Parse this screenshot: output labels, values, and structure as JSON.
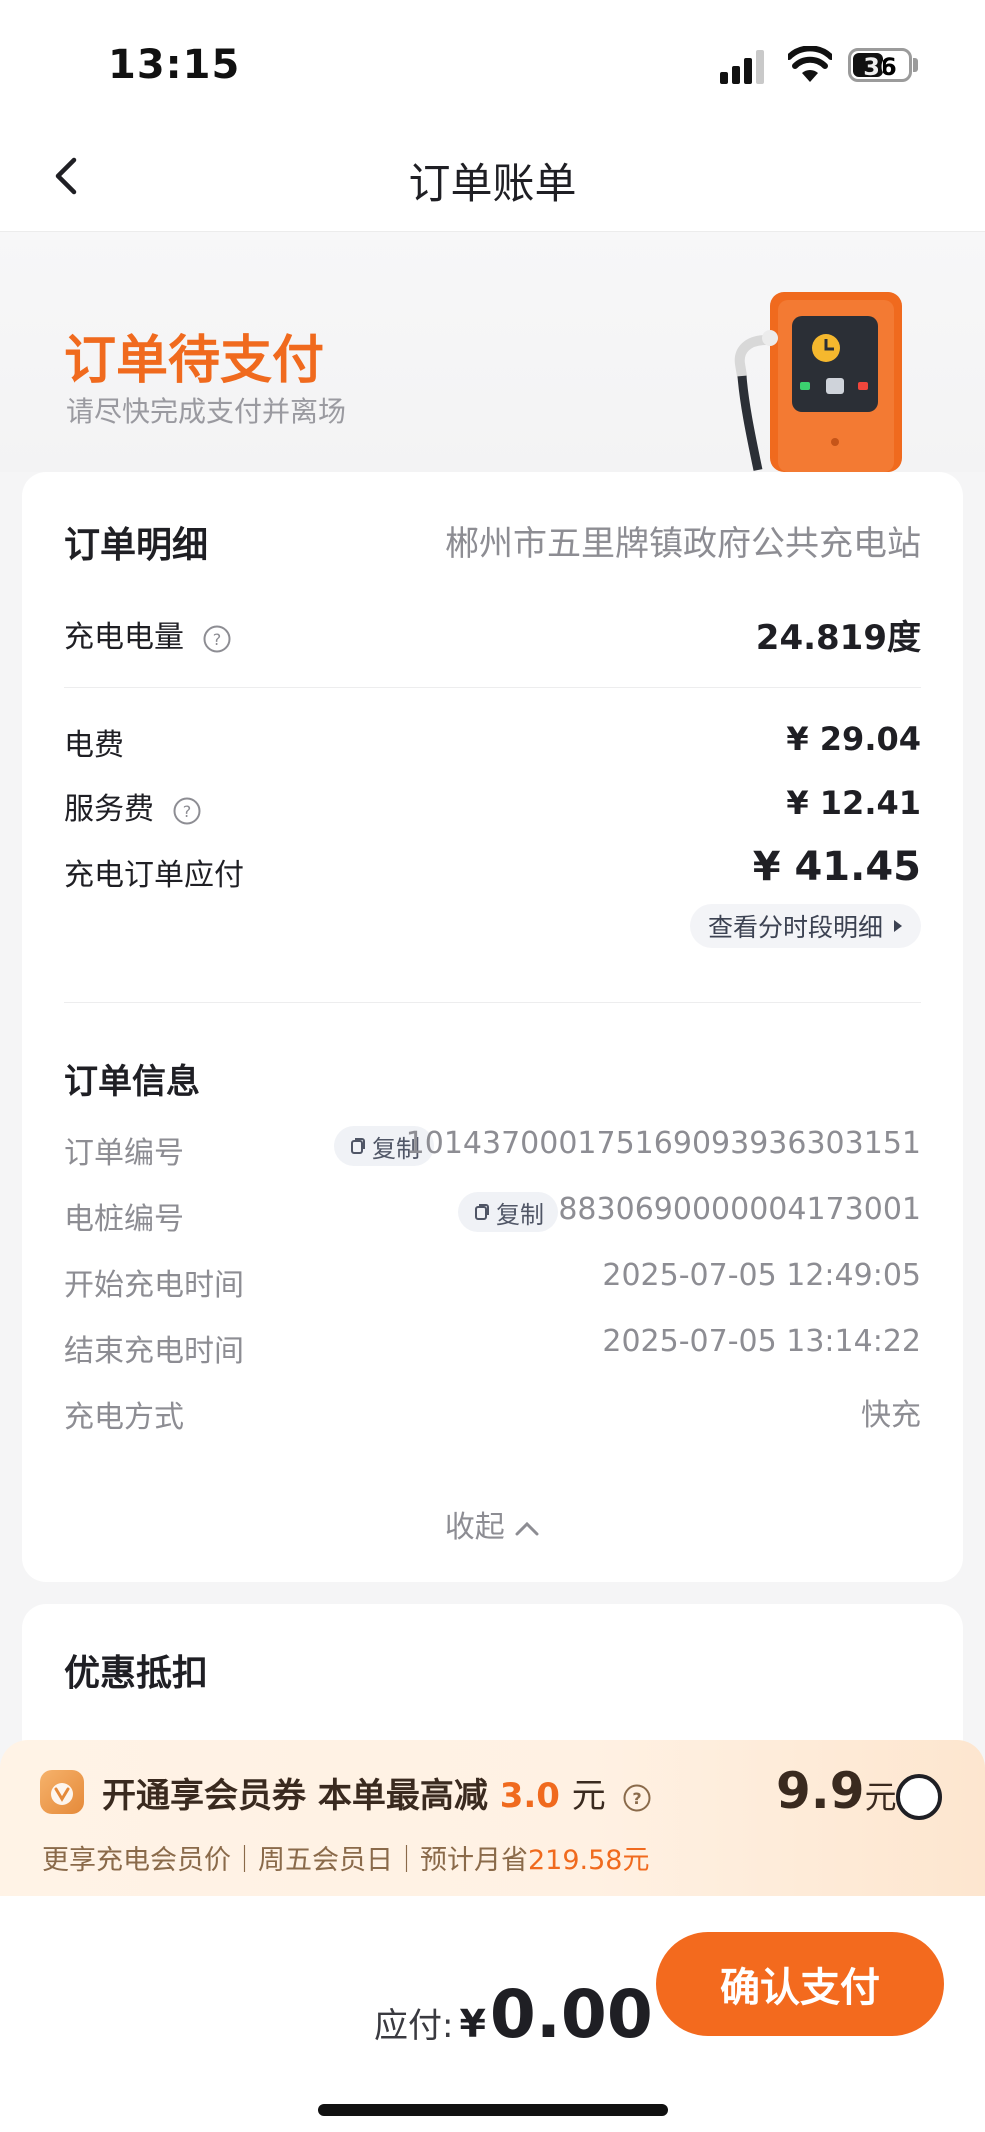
{
  "status_bar": {
    "time": "13:15",
    "battery": "36"
  },
  "nav": {
    "title": "订单账单"
  },
  "order_status": {
    "title": "订单待支付",
    "subtitle": "请尽快完成支付并离场"
  },
  "order_detail": {
    "title": "订单明细",
    "station": "郴州市五里牌镇政府公共充电站",
    "energy": {
      "label": "充电电量",
      "value": "24.819度"
    },
    "electricity_fee": {
      "label": "电费",
      "value": "¥ 29.04"
    },
    "service_fee": {
      "label": "服务费",
      "value": "¥ 12.41"
    },
    "total": {
      "label": "充电订单应付",
      "value": "¥ 41.45"
    },
    "detail_link": "查看分时段明细"
  },
  "order_info": {
    "title": "订单信息",
    "copy_label": "复制",
    "order_no": {
      "label": "订单编号",
      "value": "1014370001751690939363031​51"
    },
    "pile_no": {
      "label": "电桩编号",
      "value": "883069000000417300​1"
    },
    "start_time": {
      "label": "开始充电时间",
      "value": "2025-07-05 12:49:05"
    },
    "end_time": {
      "label": "结束充电时间",
      "value": "2025-07-05 13:14:22"
    },
    "mode": {
      "label": "充电方式",
      "value": "快充"
    },
    "collapse": "收起"
  },
  "discount": {
    "title": "优惠抵扣"
  },
  "member": {
    "title_prefix": "开通享会员券 本单最高减",
    "amount": "3.0",
    "unit": "元",
    "subtitle": "更享充电会员价｜周五会员日｜预计月省",
    "saving": "219.58元",
    "price": "9.9",
    "price_unit": "元"
  },
  "payment": {
    "label": "应付:",
    "currency": "¥",
    "amount": "0.00",
    "button": "确认支付"
  }
}
